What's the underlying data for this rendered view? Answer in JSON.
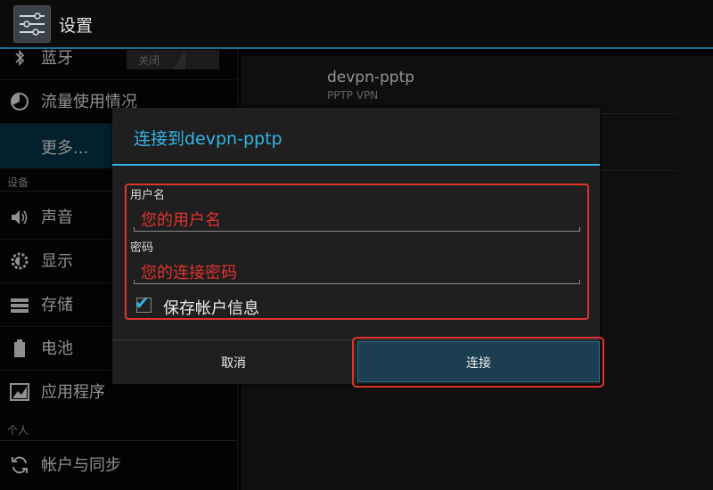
{
  "actionbar": {
    "title": "设置"
  },
  "sidebar": {
    "bluetooth": {
      "label": "蓝牙",
      "toggle": "关闭"
    },
    "items": [
      {
        "label": "流量使用情况",
        "icon": "data-usage-icon"
      },
      {
        "label": "更多...",
        "icon": ""
      }
    ],
    "section_device": "设备",
    "device_items": [
      {
        "label": "声音",
        "icon": "speaker-icon"
      },
      {
        "label": "显示",
        "icon": "brightness-icon"
      },
      {
        "label": "存储",
        "icon": "storage-icon"
      },
      {
        "label": "电池",
        "icon": "battery-icon"
      },
      {
        "label": "应用程序",
        "icon": "apps-icon"
      }
    ],
    "section_personal": "个人",
    "personal_items": [
      {
        "label": "帐户与同步",
        "icon": "sync-icon"
      }
    ]
  },
  "panel": {
    "vpn_name": "devpn-pptp",
    "vpn_type": "PPTP VPN"
  },
  "dialog": {
    "title": "连接到devpn-pptp",
    "username_label": "用户名",
    "username_value": "您的用户名",
    "password_label": "密码",
    "password_value": "您的连接密码",
    "save_label": "保存帐户信息",
    "save_checked": true,
    "cancel_label": "取消",
    "connect_label": "连接"
  },
  "colors": {
    "accent": "#33b5e5",
    "highlight": "#e0332e"
  }
}
